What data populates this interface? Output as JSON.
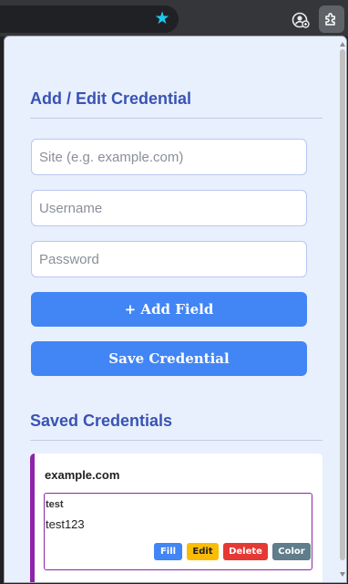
{
  "browser": {
    "star_icon": "bookmark-star-icon",
    "profile_icon": "profile-icon",
    "extensions_icon": "puzzle-icon"
  },
  "form": {
    "title": "Add / Edit Credential",
    "site_placeholder": "Site (e.g. example.com)",
    "username_placeholder": "Username",
    "password_placeholder": "Password",
    "add_field_label": "+ Add Field",
    "save_label": "Save Credential"
  },
  "saved": {
    "title": "Saved Credentials",
    "credentials": [
      {
        "site": "example.com",
        "username": "test",
        "password": "test123",
        "accent_color": "#8e24aa",
        "actions": {
          "fill": "Fill",
          "edit": "Edit",
          "delete": "Delete",
          "color": "Color"
        }
      }
    ]
  },
  "colors": {
    "accent": "#3a53b3",
    "primary_button": "#4285f4",
    "popup_bg": "#e8f0fe"
  }
}
